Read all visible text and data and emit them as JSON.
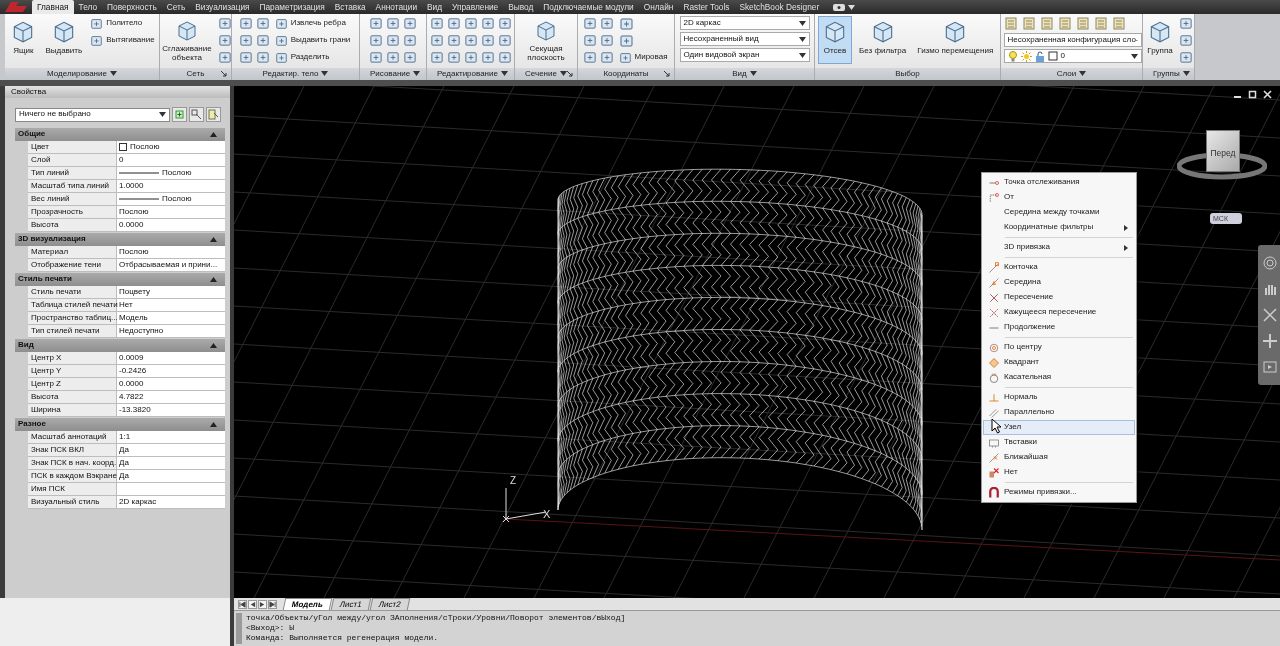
{
  "app_tabs": [
    {
      "label": "Главная",
      "selected": true
    },
    {
      "label": "Тело",
      "selected": false
    },
    {
      "label": "Поверхность",
      "selected": false
    },
    {
      "label": "Сеть",
      "selected": false
    },
    {
      "label": "Визуализация",
      "selected": false
    },
    {
      "label": "Параметризация",
      "selected": false
    },
    {
      "label": "Вставка",
      "selected": false
    },
    {
      "label": "Аннотации",
      "selected": false
    },
    {
      "label": "Вид",
      "selected": false
    },
    {
      "label": "Управление",
      "selected": false
    },
    {
      "label": "Вывод",
      "selected": false
    },
    {
      "label": "Подключаемые модули",
      "selected": false
    },
    {
      "label": "Онлайн",
      "selected": false
    },
    {
      "label": "Raster Tools",
      "selected": false
    },
    {
      "label": "SketchBook Designer",
      "selected": false
    }
  ],
  "ribbon_panels": [
    {
      "title": "Моделирование",
      "menu": true,
      "launcher": false,
      "tools": [
        {
          "kind": "large",
          "label": "Ящик"
        },
        {
          "kind": "large",
          "label": "Выдавить"
        },
        {
          "kind": "small",
          "items": [
            {
              "label": "Политело"
            },
            {
              "label": "Вытягивание"
            }
          ]
        }
      ]
    },
    {
      "title": "Сеть",
      "menu": false,
      "launcher": true,
      "tools": [
        {
          "kind": "large",
          "label": "Сглаживание объекта"
        },
        {
          "kind": "icons"
        }
      ]
    },
    {
      "title": "Редактир. тело",
      "menu": true,
      "launcher": false,
      "tools": [
        {
          "kind": "icons"
        },
        {
          "kind": "icons"
        },
        {
          "kind": "small",
          "items": [
            {
              "label": "Извлечь ребра"
            },
            {
              "label": "Выдавить грани"
            },
            {
              "label": "Разделить"
            }
          ]
        }
      ]
    },
    {
      "title": "Рисование",
      "menu": true,
      "launcher": false,
      "tools": [
        {
          "kind": "icons"
        },
        {
          "kind": "icons"
        },
        {
          "kind": "icons"
        }
      ]
    },
    {
      "title": "Редактирование",
      "menu": true,
      "launcher": false,
      "tools": [
        {
          "kind": "icons"
        },
        {
          "kind": "icons"
        },
        {
          "kind": "icons"
        },
        {
          "kind": "icons"
        },
        {
          "kind": "icons"
        }
      ]
    },
    {
      "title": "Сечение",
      "menu": true,
      "launcher": true,
      "tools": [
        {
          "kind": "large",
          "label": "Секущая плоскость"
        }
      ]
    },
    {
      "title": "Координаты",
      "menu": false,
      "launcher": true,
      "tools": [
        {
          "kind": "icons"
        },
        {
          "kind": "icons"
        },
        {
          "kind": "small",
          "items": [
            {
              "kind": "icon"
            },
            {
              "kind": "icon"
            },
            {
              "label": "Мировая"
            }
          ]
        }
      ]
    },
    {
      "title": "Вид",
      "menu": true,
      "launcher": false,
      "tools": [
        {
          "kind": "dropdowns",
          "items": [
            {
              "label": "2D каркас"
            },
            {
              "label": "Несохраненный вид"
            },
            {
              "label": "Один видовой экран"
            }
          ]
        }
      ]
    },
    {
      "title": "Выбор",
      "menu": false,
      "launcher": false,
      "tools": [
        {
          "kind": "large",
          "label": "Отсев",
          "on": true
        },
        {
          "kind": "large",
          "label": "Без фильтра",
          "on": false
        },
        {
          "kind": "large",
          "label": "Гизмо перемещения",
          "on": false
        }
      ]
    },
    {
      "title": "Слои",
      "menu": true,
      "launcher": false,
      "tools": [
        {
          "kind": "layers",
          "config": "Несохраненная конфигурация сло",
          "layer": "0"
        }
      ]
    },
    {
      "title": "Группы",
      "menu": true,
      "launcher": false,
      "tools": [
        {
          "kind": "large",
          "label": "Группа"
        },
        {
          "kind": "icons"
        }
      ]
    }
  ],
  "properties": {
    "title": "Свойства",
    "selection": "Ничего не выбрано",
    "sections": [
      {
        "title": "Общие",
        "expanded": true,
        "rows": [
          {
            "label": "Цвет",
            "value": "Послою",
            "kind": "color"
          },
          {
            "label": "Слой",
            "value": "0"
          },
          {
            "label": "Тип линий",
            "value": "Послою",
            "kind": "linetype"
          },
          {
            "label": "Масштаб типа линий",
            "value": "1.0000"
          },
          {
            "label": "Вес линий",
            "value": "Послою",
            "kind": "linetype"
          },
          {
            "label": "Прозрачность",
            "value": "Послою"
          },
          {
            "label": "Высота",
            "value": "0.0000"
          }
        ]
      },
      {
        "title": "3D визуализация",
        "expanded": true,
        "rows": [
          {
            "label": "Материал",
            "value": "Послою"
          },
          {
            "label": "Отображение тени",
            "value": "Отбрасываемая и прини..."
          }
        ]
      },
      {
        "title": "Стиль печати",
        "expanded": true,
        "rows": [
          {
            "label": "Стиль печати",
            "value": "Поцвету"
          },
          {
            "label": "Таблица стилей печати",
            "value": "Нет"
          },
          {
            "label": "Пространство таблиц...",
            "value": "Модель"
          },
          {
            "label": "Тип стилей печати",
            "value": "Недоступно"
          }
        ]
      },
      {
        "title": "Вид",
        "expanded": true,
        "rows": [
          {
            "label": "Центр X",
            "value": "0.0009"
          },
          {
            "label": "Центр Y",
            "value": "-0.2426"
          },
          {
            "label": "Центр Z",
            "value": "0.0000"
          },
          {
            "label": "Высота",
            "value": "4.7822"
          },
          {
            "label": "Ширина",
            "value": "-13.3820"
          }
        ]
      },
      {
        "title": "Разное",
        "expanded": true,
        "rows": [
          {
            "label": "Масштаб аннотаций",
            "value": "1:1"
          },
          {
            "label": "Знак ПСК ВКЛ",
            "value": "Да"
          },
          {
            "label": "Знак ПСК в нач. коорд.",
            "value": "Да"
          },
          {
            "label": "ПСК в каждом Вэкране",
            "value": "Да"
          },
          {
            "label": "Имя ПСК"
          },
          {
            "label": "Визуальный стиль",
            "value": "2D каркас"
          }
        ]
      }
    ]
  },
  "viewport": {
    "view_cube": {
      "face": "Перед",
      "ucs_badge": "МСК"
    },
    "ucs": {
      "z": "Z",
      "x": "X"
    }
  },
  "snap_menu": {
    "groups": [
      [
        {
          "label": "Точка отслеживания",
          "submenu": false,
          "selected": false
        },
        {
          "label": "От",
          "submenu": false,
          "selected": false
        },
        {
          "label": "Середина между точками",
          "submenu": false,
          "selected": false
        },
        {
          "label": "Координатные фильтры",
          "submenu": true,
          "selected": false
        }
      ],
      [
        {
          "label": "3D привязка",
          "submenu": true,
          "selected": false
        }
      ],
      [
        {
          "label": "Конточка",
          "submenu": false,
          "selected": false
        },
        {
          "label": "Середина",
          "submenu": false,
          "selected": false
        },
        {
          "label": "Пересечение",
          "submenu": false,
          "selected": false
        },
        {
          "label": "Кажущееся пересечение",
          "submenu": false,
          "selected": false
        },
        {
          "label": "Продолжение",
          "submenu": false,
          "selected": false
        }
      ],
      [
        {
          "label": "По центру",
          "submenu": false,
          "selected": false
        },
        {
          "label": "Квадрант",
          "submenu": false,
          "selected": false
        },
        {
          "label": "Касательная",
          "submenu": false,
          "selected": false
        }
      ],
      [
        {
          "label": "Нормаль",
          "submenu": false,
          "selected": false
        },
        {
          "label": "Параллельно",
          "submenu": false,
          "selected": false
        },
        {
          "label": "Узел",
          "submenu": false,
          "selected": true
        },
        {
          "label": "Твставки",
          "submenu": false,
          "selected": false
        },
        {
          "label": "Ближайшая",
          "submenu": false,
          "selected": false
        },
        {
          "label": "Нет",
          "submenu": false,
          "selected": false
        }
      ],
      [
        {
          "label": "Режимы привязки...",
          "submenu": false,
          "selected": false
        }
      ]
    ]
  },
  "layout_tabs": [
    {
      "label": "Модель",
      "selected": true
    },
    {
      "label": "Лист1",
      "selected": false
    },
    {
      "label": "Лист2",
      "selected": false
    }
  ],
  "command_lines": [
    "точка/Объекты/уГол между/угол ЗАполнения/сТроки/Уровни/Поворот элементов/вЫход]",
    "<Выход>: Ы",
    "Команда:  Выполняется регенерация модели."
  ]
}
